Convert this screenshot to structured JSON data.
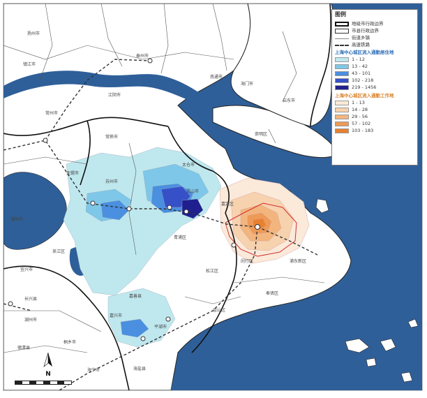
{
  "legend": {
    "title": "图例",
    "items": [
      {
        "key": "city",
        "label": "地级市行政边界"
      },
      {
        "key": "county",
        "label": "市县行政边界"
      },
      {
        "key": "street",
        "label": "街道乡镇"
      },
      {
        "key": "rail",
        "label": "高速铁路"
      }
    ],
    "residence_title": "上海中心城区流入通勤居住地",
    "residence_classes": [
      {
        "label": "1 - 12",
        "color": "#bfe8ee"
      },
      {
        "label": "13 - 42",
        "color": "#7fc7e8"
      },
      {
        "label": "43 - 101",
        "color": "#4a8fe0"
      },
      {
        "label": "102 - 218",
        "color": "#3650c8"
      },
      {
        "label": "219 - 1456",
        "color": "#1f1f8f"
      }
    ],
    "work_title": "上海中心城区流入通勤工作地",
    "work_classes": [
      {
        "label": "1 - 13",
        "color": "#fbe9d9"
      },
      {
        "label": "14 - 28",
        "color": "#f7d2ae"
      },
      {
        "label": "29 - 56",
        "color": "#f3b57e"
      },
      {
        "label": "57 - 102",
        "color": "#ee9a56"
      },
      {
        "label": "103 - 183",
        "color": "#e8802f"
      }
    ]
  },
  "colors": {
    "water": "#2f5f98",
    "land": "#ffffff",
    "boundary": "#222222",
    "rail": "#333333"
  },
  "north_label": "N",
  "places": {
    "yangzhou": "扬州市",
    "zhenjiang": "镇江市",
    "taizhou": "泰州市",
    "nantong": "南通市",
    "haimen": "海门市",
    "qidong": "启东市",
    "changzhou": "常州市",
    "jiangyin": "江阴市",
    "wuxi": "无锡市",
    "changshu": "常熟市",
    "taicang": "太仓市",
    "kunshan": "昆山市",
    "suzhou": "苏州市",
    "wujiang": "吴江区",
    "jiading": "嘉定区",
    "qingpu": "青浦区",
    "songjiang": "松江区",
    "pudong": "浦东新区",
    "jinshan": "金山区",
    "jiaxing": "嘉兴市",
    "jiashan": "嘉善县",
    "pinghu": "平湖市",
    "haiyan": "海盐县",
    "haining": "海宁市",
    "tongxiang": "桐乡市",
    "huzhou": "湖州市",
    "changxing": "长兴县",
    "deqing": "德清县",
    "yixing": "宜兴市",
    "liyang": "溧阳市",
    "fengxian": "奉贤区",
    "chongming": "崇明区",
    "minhang": "闵行区"
  }
}
